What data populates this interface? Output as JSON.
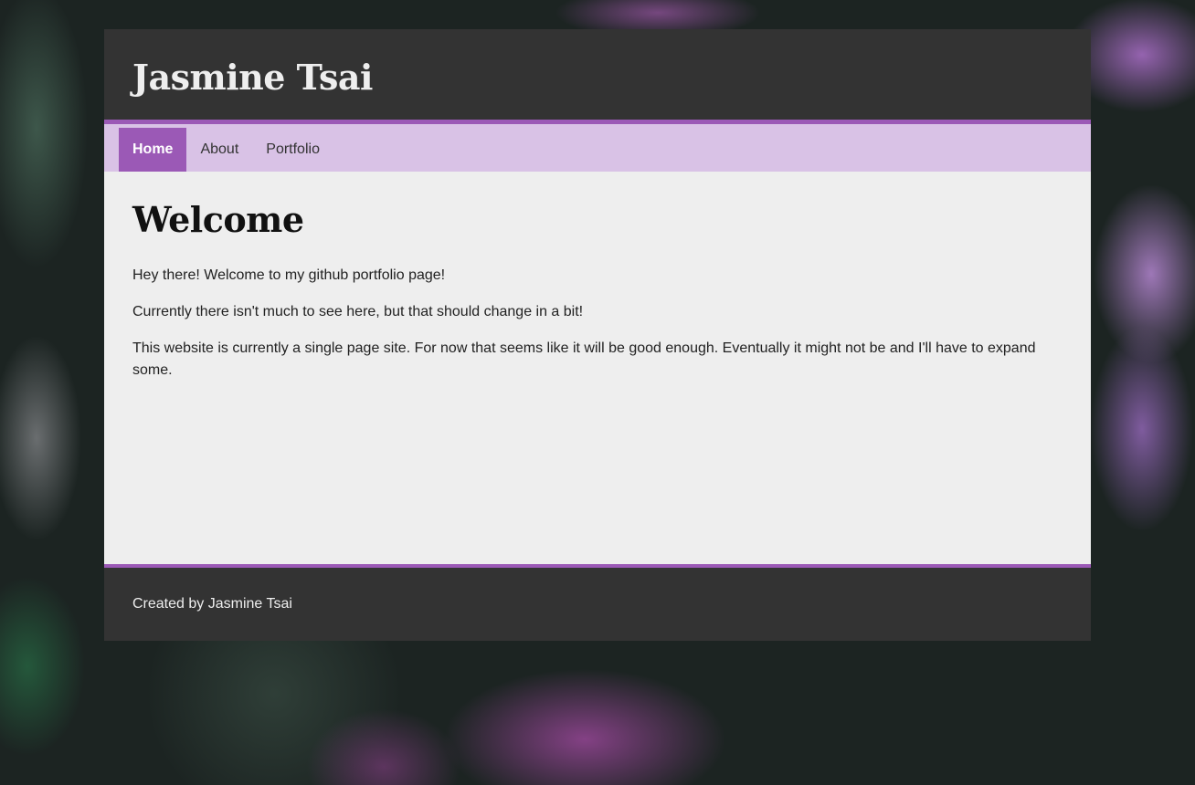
{
  "colors": {
    "accent": "#9b59b6",
    "nav_background": "#d9c2e6",
    "header_background": "#333333",
    "content_background": "#eeeeee"
  },
  "header": {
    "title": "Jasmine Tsai"
  },
  "nav": {
    "items": [
      {
        "label": "Home",
        "active": true
      },
      {
        "label": "About",
        "active": false
      },
      {
        "label": "Portfolio",
        "active": false
      }
    ]
  },
  "main": {
    "heading": "Welcome",
    "paragraphs": [
      "Hey there! Welcome to my github portfolio page!",
      "Currently there isn't much to see here, but that should change in a bit!",
      "This website is currently a single page site. For now that seems like it will be good enough. Eventually it might not be and I'll have to expand some."
    ]
  },
  "footer": {
    "text": "Created by Jasmine Tsai"
  }
}
